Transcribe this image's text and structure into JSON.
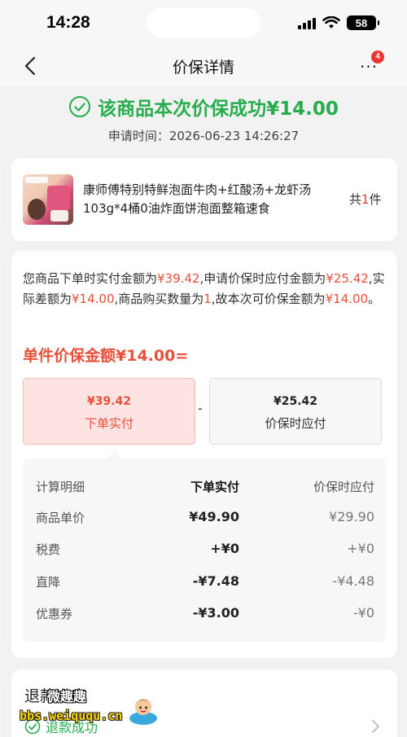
{
  "status_bar": {
    "time": "14:28",
    "battery": "58"
  },
  "nav": {
    "title": "价保详情",
    "more_badge": "4"
  },
  "success": {
    "message": "该商品本次价保成功¥14.00",
    "apply_label": "申请时间：",
    "apply_time": "2026-06-23 14:26:27"
  },
  "product": {
    "name": "康师傅特别特鲜泡面牛肉+红酸汤+龙虾汤103g*4桶0油炸面饼泡面整箱速食",
    "qty_prefix": "共",
    "qty": "1",
    "qty_suffix": "件"
  },
  "calculation": {
    "desc_1": "您商品下单时实付金额为",
    "paid_amount": "¥39.42",
    "desc_2": ",申请价保时应付金额为",
    "protect_amount": "¥25.42",
    "desc_3": ",实际差额为",
    "diff_amount": "¥14.00",
    "desc_4": ",商品购买数量为",
    "quantity": "1",
    "desc_5": ",故本次可价保金额为",
    "refund_amount": "¥14.00",
    "desc_6": "。",
    "unit_amount": "单件价保金额¥14.00=",
    "left_box": {
      "amount": "¥39.42",
      "label": "下单实付"
    },
    "minus": "-",
    "right_box": {
      "amount": "¥25.42",
      "label": "价保时应付"
    }
  },
  "detail_table": {
    "headers": [
      "计算明细",
      "下单实付",
      "价保时应付"
    ],
    "rows": [
      [
        "商品单价",
        "¥49.90",
        "¥29.90"
      ],
      [
        "税费",
        "+¥0",
        "+¥0"
      ],
      [
        "直降",
        "-¥7.48",
        "-¥4.48"
      ],
      [
        "优惠券",
        "-¥3.00",
        "-¥0"
      ]
    ]
  },
  "refund": {
    "title": "退款进度",
    "status": "退款成功"
  },
  "watermark": {
    "title": "微趣趣",
    "url": "bbs.weiququ.cn"
  },
  "colors": {
    "success_green": "#27ad4e",
    "price_red": "#e8503a",
    "badge_red": "#e33",
    "page_bg": "#f2f2f2"
  }
}
